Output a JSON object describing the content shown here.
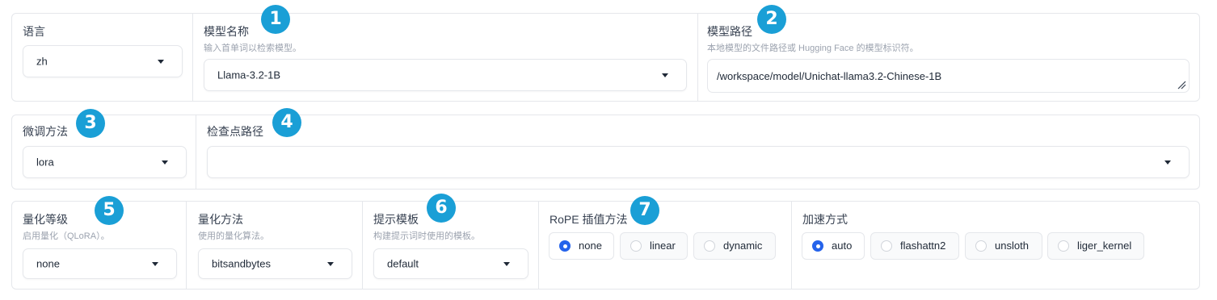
{
  "row1": {
    "language": {
      "label": "语言",
      "value": "zh"
    },
    "model_name": {
      "label": "模型名称",
      "info": "输入首单词以检索模型。",
      "value": "Llama-3.2-1B"
    },
    "model_path": {
      "label": "模型路径",
      "info": "本地模型的文件路径或 Hugging Face 的模型标识符。",
      "value": "/workspace/model/Unichat-llama3.2-Chinese-1B"
    }
  },
  "row2": {
    "finetune_method": {
      "label": "微调方法",
      "value": "lora"
    },
    "checkpoint_path": {
      "label": "检查点路径",
      "value": ""
    }
  },
  "row3": {
    "quant_level": {
      "label": "量化等级",
      "info": "启用量化（QLoRA）。",
      "value": "none"
    },
    "quant_method": {
      "label": "量化方法",
      "info": "使用的量化算法。",
      "value": "bitsandbytes"
    },
    "template": {
      "label": "提示模板",
      "info": "构建提示词时使用的模板。",
      "value": "default"
    },
    "rope": {
      "label": "RoPE 插值方法",
      "options": [
        "none",
        "linear",
        "dynamic"
      ],
      "selected": "none"
    },
    "booster": {
      "label": "加速方式",
      "options": [
        "auto",
        "flashattn2",
        "unsloth",
        "liger_kernel"
      ],
      "selected": "auto"
    }
  },
  "badges": [
    "1",
    "2",
    "3",
    "4",
    "5",
    "6",
    "7"
  ],
  "colors": {
    "badge": "#1a9fd6",
    "radio_selected": "#2563eb",
    "border": "#e5e7eb"
  }
}
